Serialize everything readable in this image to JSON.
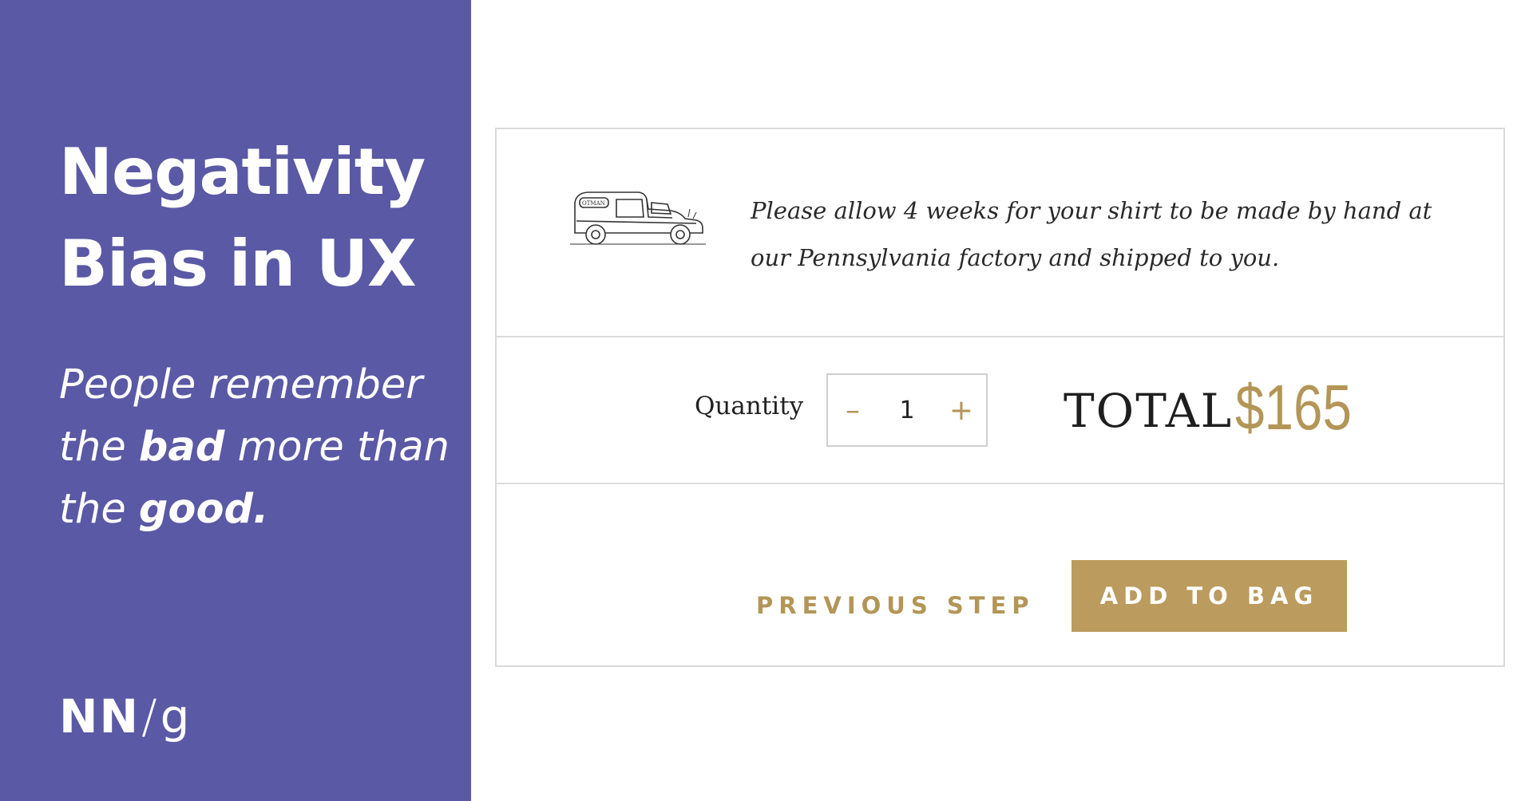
{
  "left_panel": {
    "headline_line1": "Negativity",
    "headline_line2": "Bias in UX",
    "tagline": {
      "part1": "People remember the ",
      "bad": "bad",
      "part2": " more than the ",
      "good": "good."
    },
    "logo": {
      "nn": "NN",
      "slash": "/",
      "g": "g"
    },
    "background_color": "#5a59a5"
  },
  "checkout": {
    "shipping_notice": {
      "icon": "delivery-truck-illustration",
      "text": "Please allow 4 weeks for your shirt to be made by hand at our Pennsylvania factory and shipped to you."
    },
    "quantity": {
      "label": "Quantity",
      "decrement_symbol": "–",
      "increment_symbol": "+",
      "value": "1"
    },
    "total": {
      "label": "TOTAL",
      "price": "$165"
    },
    "actions": {
      "previous_step_label": "PREVIOUS STEP",
      "add_to_bag_label": "ADD TO BAG"
    },
    "accent_color": "#b39657"
  }
}
